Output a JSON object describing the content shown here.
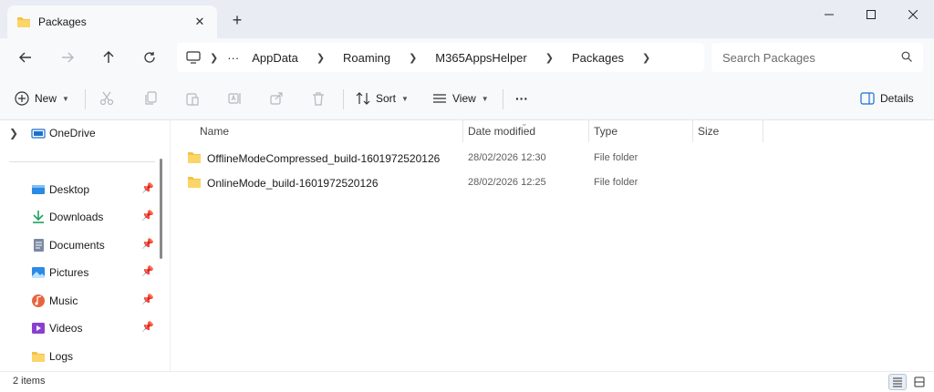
{
  "window": {
    "tab_title": "Packages",
    "tab_close": "✕",
    "new_tab": "+"
  },
  "address_bar": {
    "overflow": "···",
    "segments": [
      "AppData",
      "Roaming",
      "M365AppsHelper",
      "Packages"
    ]
  },
  "search": {
    "placeholder": "Search Packages"
  },
  "commands": {
    "new_label": "New",
    "sort_label": "Sort",
    "view_label": "View",
    "more_label": "···",
    "details_label": "Details"
  },
  "nav": {
    "onedrive": "OneDrive",
    "items": [
      {
        "label": "Desktop",
        "icon": "desktop-icon"
      },
      {
        "label": "Downloads",
        "icon": "downloads-icon"
      },
      {
        "label": "Documents",
        "icon": "documents-icon"
      },
      {
        "label": "Pictures",
        "icon": "pictures-icon"
      },
      {
        "label": "Music",
        "icon": "music-icon"
      },
      {
        "label": "Videos",
        "icon": "videos-icon"
      },
      {
        "label": "Logs",
        "icon": "folder-icon"
      }
    ]
  },
  "columns": {
    "name": "Name",
    "date": "Date modified",
    "type": "Type",
    "size": "Size"
  },
  "files": [
    {
      "name": "OfflineModeCompressed_build-1601972520126",
      "date": "28/02/2026 12:30",
      "type": "File folder"
    },
    {
      "name": "OnlineMode_build-1601972520126",
      "date": "28/02/2026 12:25",
      "type": "File folder"
    }
  ],
  "status": {
    "count": "2 items"
  },
  "colors": {
    "folder": "#f6c244",
    "accent": "#1c6fd0"
  }
}
